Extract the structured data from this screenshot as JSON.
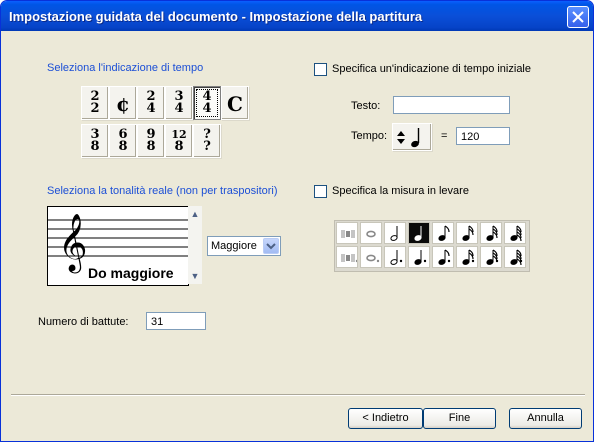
{
  "window": {
    "title": "Impostazione guidata del documento - Impostazione della partitura"
  },
  "time_signature": {
    "heading": "Seleziona l'indicazione di tempo",
    "row1": [
      {
        "n": "2",
        "d": "2",
        "name": "2-2"
      },
      {
        "symbol": "¢",
        "name": "cut-time"
      },
      {
        "n": "2",
        "d": "4",
        "name": "2-4"
      },
      {
        "n": "3",
        "d": "4",
        "name": "3-4"
      },
      {
        "n": "4",
        "d": "4",
        "name": "4-4",
        "selected": true
      },
      {
        "symbol": "C",
        "name": "common-time"
      }
    ],
    "row2": [
      {
        "n": "3",
        "d": "8",
        "name": "3-8"
      },
      {
        "n": "6",
        "d": "8",
        "name": "6-8"
      },
      {
        "n": "9",
        "d": "8",
        "name": "9-8"
      },
      {
        "n": "12",
        "d": "8",
        "name": "12-8"
      },
      {
        "n": "?",
        "d": "?",
        "name": "custom"
      }
    ]
  },
  "tempo": {
    "checkbox_label": "Specifica un'indicazione di tempo iniziale",
    "text_label": "Testo:",
    "text_value": "",
    "tempo_label": "Tempo:",
    "equals": "=",
    "bpm": "120"
  },
  "key": {
    "heading": "Seleziona la tonalità reale (non per traspositori)",
    "key_name": "Do maggiore",
    "mode_selected": "Maggiore"
  },
  "pickup": {
    "checkbox_label": "Specifica la misura in levare",
    "row1": [
      "double-rest",
      "whole",
      "half",
      "quarter",
      "eighth",
      "sixteenth",
      "thirty-second",
      "sixty-fourth"
    ],
    "row2": [
      "dotted-double-rest",
      "dotted-whole",
      "dotted-half",
      "dotted-quarter",
      "dotted-eighth",
      "dotted-sixteenth",
      "dotted-thirty-second",
      "dotted-sixty-fourth"
    ],
    "selected": "quarter"
  },
  "measures": {
    "label": "Numero di battute:",
    "value": "31"
  },
  "buttons": {
    "back": "< Indietro",
    "finish": "Fine",
    "cancel": "Annulla"
  }
}
